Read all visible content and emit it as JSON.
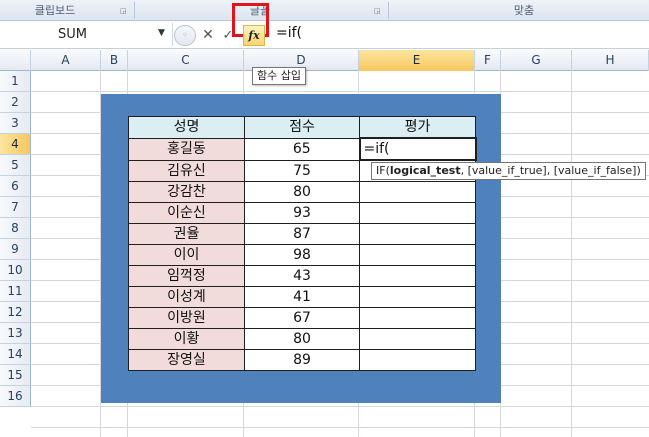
{
  "ribbon": {
    "groups": [
      "클립보드",
      "글꼴",
      "맞춤"
    ]
  },
  "formula_bar": {
    "name_box": "SUM",
    "cancel_symbol": "✕",
    "enter_symbol": "✓",
    "fx_label": "fx",
    "formula": "=if("
  },
  "tooltip": {
    "insert_function": "함수 삽입"
  },
  "columns": [
    "A",
    "B",
    "C",
    "D",
    "E",
    "F",
    "G",
    "H"
  ],
  "selected_column": "E",
  "rows": [
    "1",
    "2",
    "3",
    "4",
    "5",
    "6",
    "7",
    "8",
    "9",
    "10",
    "11",
    "12",
    "13",
    "14",
    "15",
    "16"
  ],
  "selected_row": "4",
  "table": {
    "headers": [
      "성명",
      "점수",
      "평가"
    ],
    "rows": [
      {
        "name": "홍길동",
        "score": "65",
        "grade": "=if("
      },
      {
        "name": "김유신",
        "score": "75",
        "grade": ""
      },
      {
        "name": "강감찬",
        "score": "80",
        "grade": ""
      },
      {
        "name": "이순신",
        "score": "93",
        "grade": ""
      },
      {
        "name": "권율",
        "score": "87",
        "grade": ""
      },
      {
        "name": "이이",
        "score": "98",
        "grade": ""
      },
      {
        "name": "임꺽정",
        "score": "43",
        "grade": ""
      },
      {
        "name": "이성계",
        "score": "41",
        "grade": ""
      },
      {
        "name": "이방원",
        "score": "67",
        "grade": ""
      },
      {
        "name": "이황",
        "score": "80",
        "grade": ""
      },
      {
        "name": "장영실",
        "score": "89",
        "grade": ""
      }
    ]
  },
  "arg_hint": {
    "func": "IF(",
    "arg1": "logical_test",
    "rest": ", [value_if_true], [value_if_false])"
  },
  "colors": {
    "box_fill": "#4f81bd",
    "name_cell_fill": "#f2dcdb",
    "header_fill": "#daeef3",
    "highlight": "#e0141b"
  }
}
